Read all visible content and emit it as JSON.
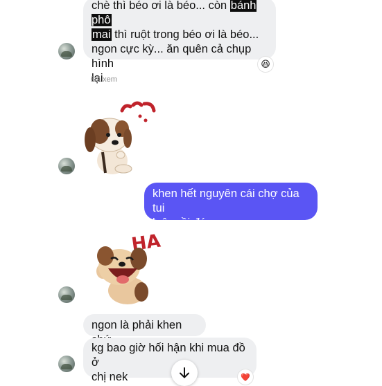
{
  "thread": {
    "msg1": {
      "line1_pre": "chè thì béo ơi là béo... còn ",
      "line1_hl": "bánh phô",
      "line2_hl": "mai",
      "line2_post": " thì ruột trong béo ơi là béo...",
      "line3": "ngon cực kỳ... ăn quên cả chụp hình",
      "line4": "lại",
      "reaction": "😆"
    },
    "seen_label": "Đã xem",
    "outgoing": {
      "line1": "khen hết nguyên cái chợ của tui",
      "line2": "luôn rồi đó"
    },
    "sticker2_text": "HA",
    "msg_reply1": "ngon là phải khen chứ",
    "msg_reply2": {
      "line1": "kg bao giờ hối hận khi mua đồ ở",
      "line2": "chị nek",
      "reaction": "❤️"
    }
  },
  "colors": {
    "incoming_bg": "#eeeff1",
    "outgoing_bg": "#5a55f4",
    "sticker_red": "#c0232b"
  }
}
